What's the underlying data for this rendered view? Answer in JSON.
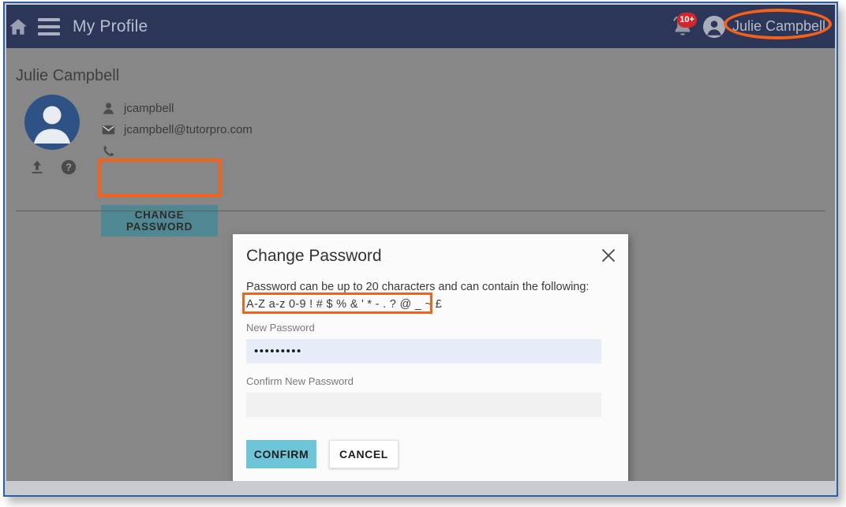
{
  "topbar": {
    "home_icon": "home-icon",
    "menu_icon": "hamburger-menu-icon",
    "title": "My Profile",
    "notifications": {
      "icon": "bell-icon",
      "badge": "10+"
    },
    "user": {
      "avatar_icon": "user-avatar-icon",
      "name": "Julie Campbell"
    }
  },
  "profile": {
    "name": "Julie Campbell",
    "avatar_icon": "user-avatar-large-icon",
    "tools": {
      "upload_icon": "upload-icon",
      "help_icon": "help-icon"
    },
    "fields": [
      {
        "icon": "person-icon",
        "value": "jcampbell"
      },
      {
        "icon": "envelope-icon",
        "value": "jcampbell@tutorpro.com"
      },
      {
        "icon": "phone-icon",
        "value": ""
      }
    ],
    "change_password_label": "CHANGE PASSWORD"
  },
  "dialog": {
    "title": "Change Password",
    "close_icon": "close-icon",
    "hint_line_1": "Password can be up to 20 characters and can contain the following:",
    "hint_line_2": "A-Z a-z 0-9 ! # $ % & ' * - . ? @ _ ~ £",
    "new_password": {
      "label": "New Password",
      "value": "•••••••••",
      "placeholder": ""
    },
    "confirm_password": {
      "label": "Confirm New Password",
      "value": "",
      "placeholder": ""
    },
    "confirm_label": "CONFIRM",
    "cancel_label": "CANCEL"
  },
  "colors": {
    "topbar_navy": "#2b3658",
    "content_gray": "#878787",
    "annotation_orange": "#f4611a",
    "confirm_teal": "#6ec5d9",
    "change_password_teal": "#4f8893",
    "badge_red": "#d3262b",
    "window_border_blue": "#2d5fa4"
  }
}
